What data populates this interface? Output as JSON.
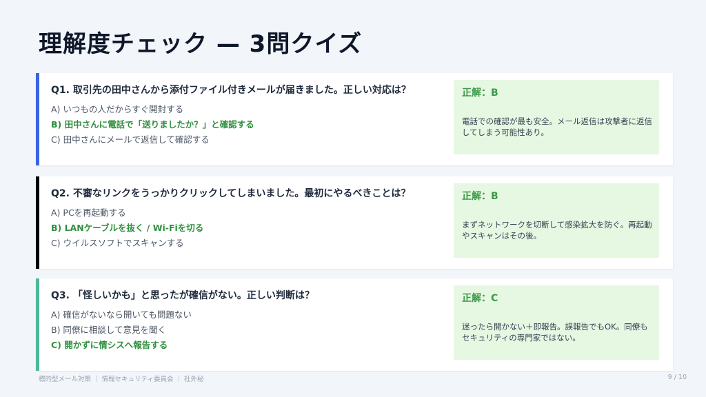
{
  "title": "理解度チェック — 3問クイズ",
  "colors": {
    "accent_q1": "#3b63e0",
    "accent_q2": "#000000",
    "accent_q3": "#4fb89a",
    "correct": "#2f8f3e",
    "answer_bg": "#e6f7e2"
  },
  "questions": [
    {
      "question": "Q1. 取引先の田中さんから添付ファイル付きメールが届きました。正しい対応は？",
      "options": [
        {
          "text": "A) いつもの人だからすぐ開封する",
          "correct": false
        },
        {
          "text": "B) 田中さんに電話で「送りましたか？」と確認する",
          "correct": true
        },
        {
          "text": "C) 田中さんにメールで返信して確認する",
          "correct": false
        }
      ],
      "answer_label": "正解：B",
      "explanation": "電話での確認が最も安全。メール返信は攻撃者に返信してしまう可能性あり。"
    },
    {
      "question": "Q2. 不審なリンクをうっかりクリックしてしまいました。最初にやるべきことは？",
      "options": [
        {
          "text": "A) PCを再起動する",
          "correct": false
        },
        {
          "text": "B) LANケーブルを抜く / Wi-Fiを切る",
          "correct": true
        },
        {
          "text": "C) ウイルスソフトでスキャンする",
          "correct": false
        }
      ],
      "answer_label": "正解：B",
      "explanation": "まずネットワークを切断して感染拡大を防ぐ。再起動やスキャンはその後。"
    },
    {
      "question": "Q3. 「怪しいかも」と思ったが確信がない。正しい判断は？",
      "options": [
        {
          "text": "A) 確信がないなら開いても問題ない",
          "correct": false
        },
        {
          "text": "B) 同僚に相談して意見を聞く",
          "correct": false
        },
        {
          "text": "C) 開かずに情シスへ報告する",
          "correct": true
        }
      ],
      "answer_label": "正解：C",
      "explanation": "迷ったら開かない＋即報告。誤報告でもOK。同僚もセキュリティの専門家ではない。"
    }
  ],
  "footer": "標的型メール対策 ｜ 情報セキュリティ委員会 ｜ 社外秘",
  "page": "9 / 10"
}
